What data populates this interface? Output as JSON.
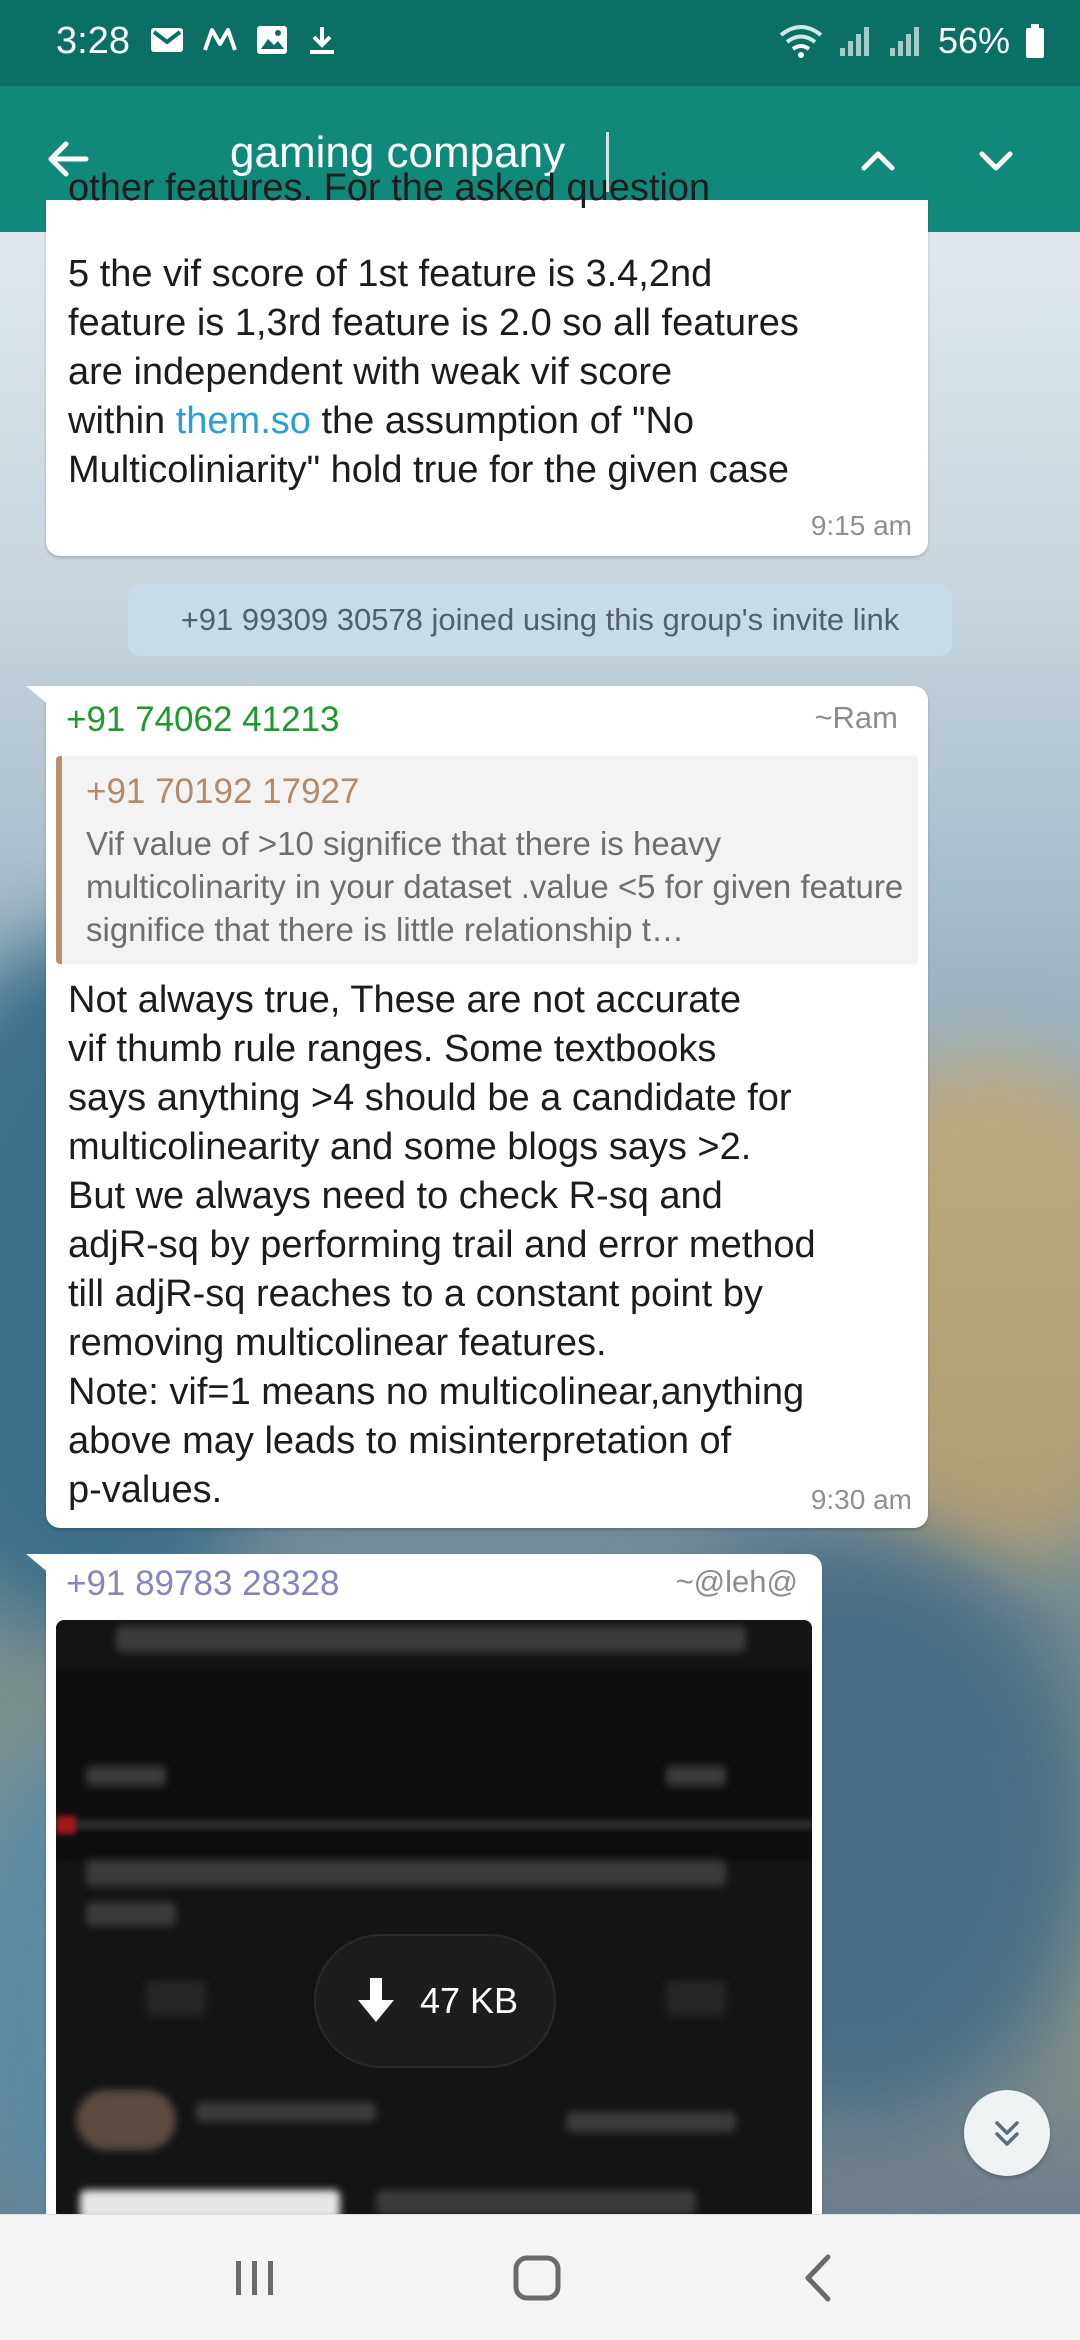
{
  "status_bar": {
    "time": "3:28",
    "left_icons": [
      "gmail-icon",
      "motorola-icon",
      "image-icon",
      "download-icon"
    ],
    "battery": "56%",
    "right_icons": [
      "wifi-icon",
      "signal-icon",
      "signal-icon",
      "battery-icon"
    ]
  },
  "search_bar": {
    "query": "gaming company"
  },
  "messages": [
    {
      "type": "text",
      "lines": [
        "5 the vif score of 1st feature is 3.4,2nd",
        "feature is 1,3rd feature is 2.0 so all features",
        "are independent with weak vif score"
      ],
      "link_line_prefix": "within ",
      "link_text": "them.so",
      "link_line_suffix": " the assumption of \"No",
      "last_line": "Multicoliniarity\" hold true for the given case",
      "cut_top_line": "other features. For the asked question",
      "time": "9:15 am"
    },
    {
      "type": "system",
      "text": "+91 99309 30578 joined using this group's invite link"
    },
    {
      "type": "reply",
      "sender": "+91 74062 41213",
      "alias": "~Ram",
      "quote": {
        "sender": "+91 70192 17927",
        "text": "Vif value of >10 significe that there is heavy multicolinarity in your dataset .value <5 for given feature significe that there is little relationship t…"
      },
      "text_lines": [
        "Not always true, These are not accurate",
        "vif thumb rule ranges. Some textbooks",
        "says anything >4 should be a candidate for",
        "multicolinearity and some blogs says >2.",
        "But we always need to check R-sq and",
        "adjR-sq by performing trail and error method",
        "till adjR-sq reaches to a constant point by",
        "removing multicolinear features.",
        "Note: vif=1 means no multicolinear,anything",
        "above may leads to misinterpretation of",
        "p-values."
      ],
      "time": "9:30 am"
    },
    {
      "type": "media",
      "sender": "+91 89783 28328",
      "alias": "~@leh@",
      "download_size": "47 KB"
    }
  ],
  "colors": {
    "status_bar": "#0b6f63",
    "app_bar": "#11897a",
    "sender_green": "#1e9a2c",
    "sender_purple": "#8486bd",
    "quote_sender": "#b48a6c",
    "link": "#2a9fd6"
  }
}
